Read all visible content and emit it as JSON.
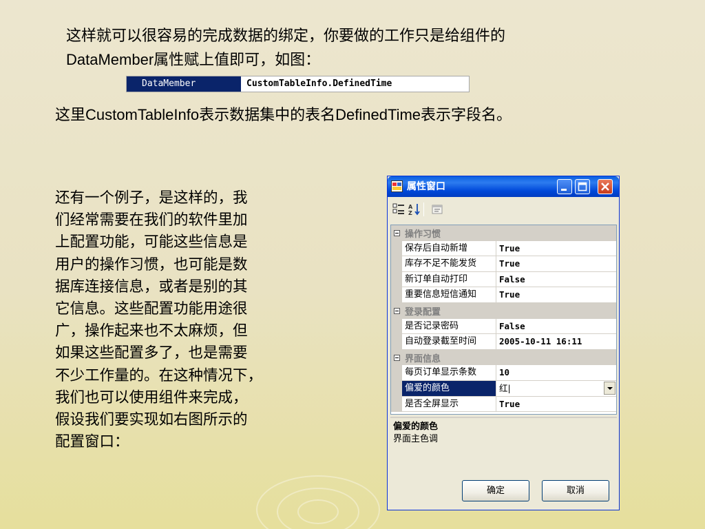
{
  "slide": {
    "para1_part1": "这样就可以很容易的完成数据的绑定，你要做的工作只是给组件的",
    "para1_part2_latin": "DataMember",
    "para1_part2": "属性赋上值即可，如图：",
    "datamember_name": "DataMember",
    "datamember_value": "CustomTableInfo.DefinedTime",
    "para2_a": "这里",
    "para2_b": "CustomTableInfo",
    "para2_c": "表示数据集中的表名",
    "para2_d": "DefinedTime",
    "para2_e": "表示字段名。",
    "para3_lines": [
      "还有一个例子，是这样的，我",
      "们经常需要在我们的软件里加",
      "上配置功能，可能这些信息是",
      "用户的操作习惯，也可能是数",
      "据库连接信息，或者是别的其",
      "它信息。这些配置功能用途很",
      "广，操作起来也不太麻烦，但",
      "如果这些配置多了，也是需要",
      "不少工作量的。在这种情况下，",
      "我们也可以使用组件来完成，",
      "假设我们要实现如右图所示的",
      "配置窗口："
    ]
  },
  "window": {
    "title": "属性窗口",
    "categories": [
      {
        "label": "操作习惯",
        "rows": [
          {
            "name": "保存后自动新增",
            "value": "True"
          },
          {
            "name": "库存不足不能发货",
            "value": "True"
          },
          {
            "name": "新订单自动打印",
            "value": "False"
          },
          {
            "name": "重要信息短信通知",
            "value": "True"
          }
        ]
      },
      {
        "label": "登录配置",
        "rows": [
          {
            "name": "是否记录密码",
            "value": "False"
          },
          {
            "name": "自动登录截至时间",
            "value": "2005-10-11 16:11"
          }
        ]
      },
      {
        "label": "界面信息",
        "rows": [
          {
            "name": "每页订单显示条数",
            "value": "10"
          },
          {
            "name": "偏爱的颜色",
            "value": "红|",
            "selected": true
          },
          {
            "name": "是否全屏显示",
            "value": "True"
          }
        ]
      }
    ],
    "description_title": "偏爱的颜色",
    "description_text": "界面主色调",
    "ok_label": "确定",
    "cancel_label": "取消"
  },
  "colors": {
    "title_bar": "#0a5fe0",
    "selection": "#0a246a",
    "category_bg": "#d4d0c8",
    "window_bg": "#ece9d8"
  }
}
